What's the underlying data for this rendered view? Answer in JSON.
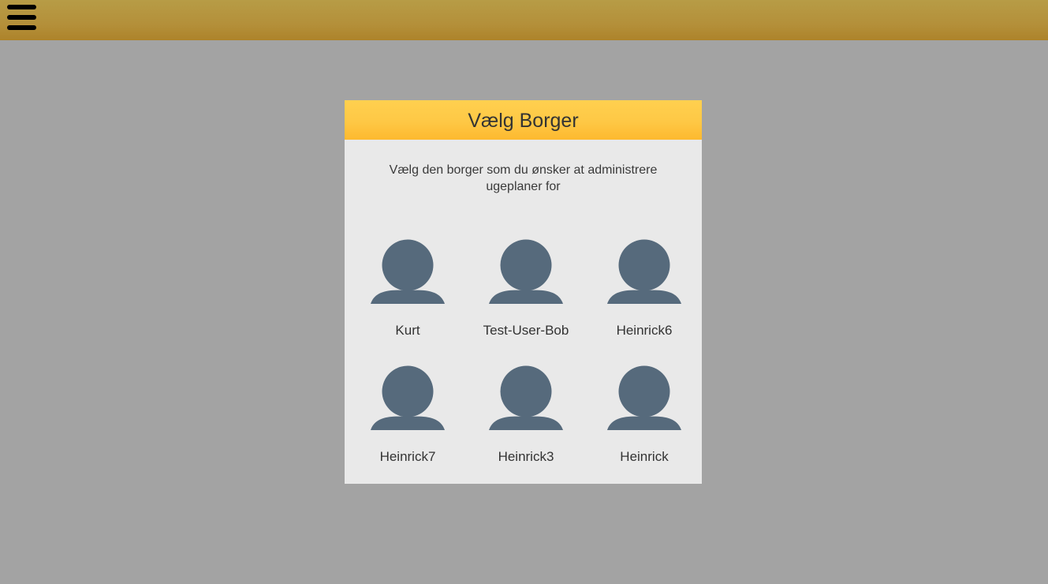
{
  "topbar": {
    "menu_icon": "hamburger-menu-icon"
  },
  "dialog": {
    "title": "Vælg Borger",
    "subtitle": "Vælg den borger som du ønsker at administrere ugeplaner for",
    "avatar_icon": "person-silhouette-icon",
    "avatar_color": "#566a7c",
    "users": [
      {
        "name": "Kurt"
      },
      {
        "name": "Test-User-Bob"
      },
      {
        "name": "Heinrick6"
      },
      {
        "name": "Heinrick7"
      },
      {
        "name": "Heinrick3"
      },
      {
        "name": "Heinrick"
      }
    ]
  },
  "colors": {
    "topbar": "#b4903a",
    "header": "#fec845",
    "backdrop": "#a3a3a3",
    "dialog_bg": "#e9e9e9"
  }
}
